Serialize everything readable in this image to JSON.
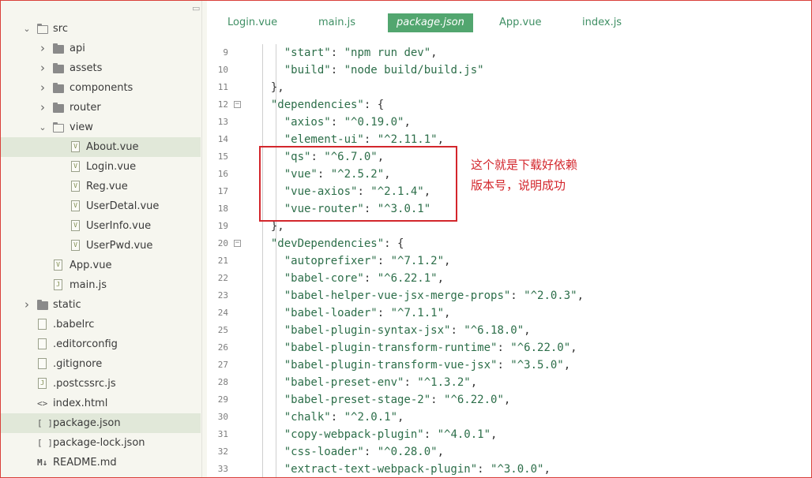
{
  "sidebar": {
    "items": [
      {
        "label": "src",
        "kind": "folder-open",
        "level": 0,
        "chevron": "down"
      },
      {
        "label": "api",
        "kind": "folder",
        "level": 1,
        "chevron": "right"
      },
      {
        "label": "assets",
        "kind": "folder",
        "level": 1,
        "chevron": "right"
      },
      {
        "label": "components",
        "kind": "folder",
        "level": 1,
        "chevron": "right"
      },
      {
        "label": "router",
        "kind": "folder",
        "level": 1,
        "chevron": "right"
      },
      {
        "label": "view",
        "kind": "folder-open",
        "level": 1,
        "chevron": "down"
      },
      {
        "label": "About.vue",
        "kind": "vue",
        "level": 2,
        "active": true
      },
      {
        "label": "Login.vue",
        "kind": "vue",
        "level": 2
      },
      {
        "label": "Reg.vue",
        "kind": "vue",
        "level": 2
      },
      {
        "label": "UserDetal.vue",
        "kind": "vue",
        "level": 2
      },
      {
        "label": "UserInfo.vue",
        "kind": "vue",
        "level": 2
      },
      {
        "label": "UserPwd.vue",
        "kind": "vue",
        "level": 2
      },
      {
        "label": "App.vue",
        "kind": "vue",
        "level": 1
      },
      {
        "label": "main.js",
        "kind": "js",
        "level": 1
      },
      {
        "label": "static",
        "kind": "folder",
        "level": 0,
        "chevron": "right"
      },
      {
        "label": ".babelrc",
        "kind": "file",
        "level": 0
      },
      {
        "label": ".editorconfig",
        "kind": "file",
        "level": 0
      },
      {
        "label": ".gitignore",
        "kind": "file",
        "level": 0
      },
      {
        "label": ".postcssrc.js",
        "kind": "js",
        "level": 0
      },
      {
        "label": "index.html",
        "kind": "html",
        "level": 0
      },
      {
        "label": "package.json",
        "kind": "json",
        "level": 0,
        "active": true
      },
      {
        "label": "package-lock.json",
        "kind": "json",
        "level": 0
      },
      {
        "label": "README.md",
        "kind": "md",
        "level": 0
      }
    ]
  },
  "tabs": [
    {
      "label": "Login.vue"
    },
    {
      "label": "main.js"
    },
    {
      "label": "package.json",
      "active": true
    },
    {
      "label": "App.vue"
    },
    {
      "label": "index.js"
    }
  ],
  "code": {
    "lines": [
      {
        "n": "9",
        "text": "    \"start\": \"npm run dev\","
      },
      {
        "n": "10",
        "text": "    \"build\": \"node build/build.js\""
      },
      {
        "n": "11",
        "text": "  },"
      },
      {
        "n": "12",
        "text": "  \"dependencies\": {",
        "fold": true
      },
      {
        "n": "13",
        "text": "    \"axios\": \"^0.19.0\","
      },
      {
        "n": "14",
        "text": "    \"element-ui\": \"^2.11.1\","
      },
      {
        "n": "15",
        "text": "    \"qs\": \"^6.7.0\","
      },
      {
        "n": "16",
        "text": "    \"vue\": \"^2.5.2\","
      },
      {
        "n": "17",
        "text": "    \"vue-axios\": \"^2.1.4\","
      },
      {
        "n": "18",
        "text": "    \"vue-router\": \"^3.0.1\""
      },
      {
        "n": "19",
        "text": "  },"
      },
      {
        "n": "20",
        "text": "  \"devDependencies\": {",
        "fold": true
      },
      {
        "n": "21",
        "text": "    \"autoprefixer\": \"^7.1.2\","
      },
      {
        "n": "22",
        "text": "    \"babel-core\": \"^6.22.1\","
      },
      {
        "n": "23",
        "text": "    \"babel-helper-vue-jsx-merge-props\": \"^2.0.3\","
      },
      {
        "n": "24",
        "text": "    \"babel-loader\": \"^7.1.1\","
      },
      {
        "n": "25",
        "text": "    \"babel-plugin-syntax-jsx\": \"^6.18.0\","
      },
      {
        "n": "26",
        "text": "    \"babel-plugin-transform-runtime\": \"^6.22.0\","
      },
      {
        "n": "27",
        "text": "    \"babel-plugin-transform-vue-jsx\": \"^3.5.0\","
      },
      {
        "n": "28",
        "text": "    \"babel-preset-env\": \"^1.3.2\","
      },
      {
        "n": "29",
        "text": "    \"babel-preset-stage-2\": \"^6.22.0\","
      },
      {
        "n": "30",
        "text": "    \"chalk\": \"^2.0.1\","
      },
      {
        "n": "31",
        "text": "    \"copy-webpack-plugin\": \"^4.0.1\","
      },
      {
        "n": "32",
        "text": "    \"css-loader\": \"^0.28.0\","
      },
      {
        "n": "33",
        "text": "    \"extract-text-webpack-plugin\": \"^3.0.0\","
      }
    ]
  },
  "annotation": {
    "line1": "这个就是下载好依赖",
    "line2": "版本号，说明成功"
  },
  "colors": {
    "accent": "#52a66f",
    "tab_text": "#3f8f64",
    "annotation": "#d3262c",
    "sidebar_bg": "#f6f6ef",
    "active_row": "#e1e8d9"
  }
}
